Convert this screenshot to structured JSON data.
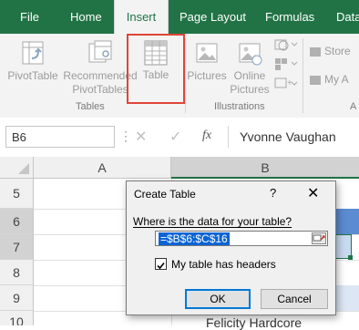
{
  "ribbon_tabs": [
    "File",
    "Home",
    "Insert",
    "Page Layout",
    "Formulas",
    "Data"
  ],
  "active_tab": "Insert",
  "ribbon": {
    "pivottable": "PivotTable",
    "recommended_line1": "Recommended",
    "recommended_line2": "PivotTables",
    "table": "Table",
    "pictures": "Pictures",
    "online_line1": "Online",
    "online_line2": "Pictures",
    "store": "Store",
    "my_addins": "My A",
    "group_tables": "Tables",
    "group_illustrations": "Illustrations",
    "group_addins": "A"
  },
  "formula_bar": {
    "name_box": "B6",
    "fx": "fx",
    "content": "Yvonne Vaughan"
  },
  "grid": {
    "columns": [
      "A",
      "B"
    ],
    "rows": [
      "5",
      "6",
      "7",
      "8",
      "9",
      "10"
    ],
    "partial_cell_text": "Felicity Hardcore"
  },
  "dialog": {
    "title": "Create Table",
    "help": "?",
    "close": "✕",
    "prompt": "Where is the data for your table?",
    "range_value": "=$B$6:$C$16",
    "headers_label": "My table has headers",
    "headers_checked": true,
    "ok": "OK",
    "cancel": "Cancel"
  },
  "colors": {
    "excel_green": "#217346",
    "highlight_red": "#e0443a",
    "selection_blue": "#0a64d4"
  }
}
